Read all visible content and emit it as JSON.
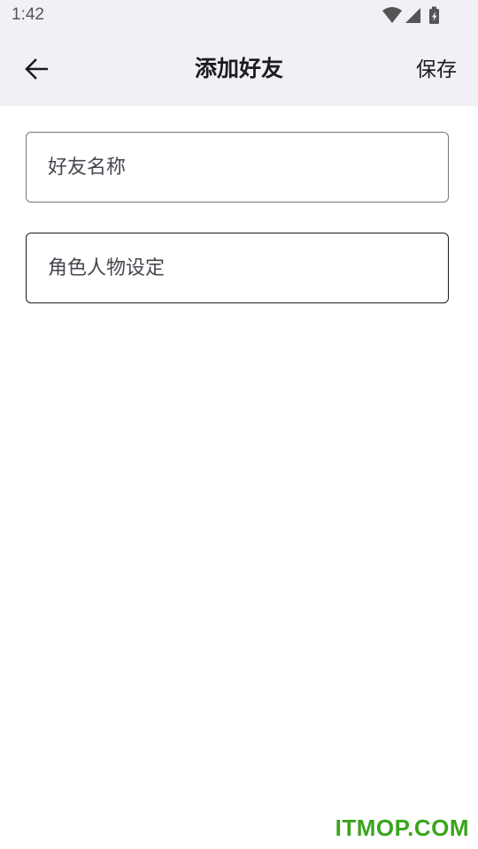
{
  "status_bar": {
    "time": "1:42",
    "icons": [
      "wifi-icon",
      "cellular-signal-icon",
      "battery-charging-icon"
    ]
  },
  "app_bar": {
    "back_icon": "arrow-back-icon",
    "title": "添加好友",
    "save_label": "保存"
  },
  "form": {
    "friend_name": {
      "value": "",
      "placeholder": "好友名称"
    },
    "character_setting": {
      "value": "",
      "placeholder": "角色人物设定"
    }
  },
  "watermark": "ITMOP.COM",
  "colors": {
    "app_bar_background": "#f3eff6",
    "text_primary": "#1c1b1f",
    "outline": "#79747e",
    "watermark": "#3aa41d"
  }
}
